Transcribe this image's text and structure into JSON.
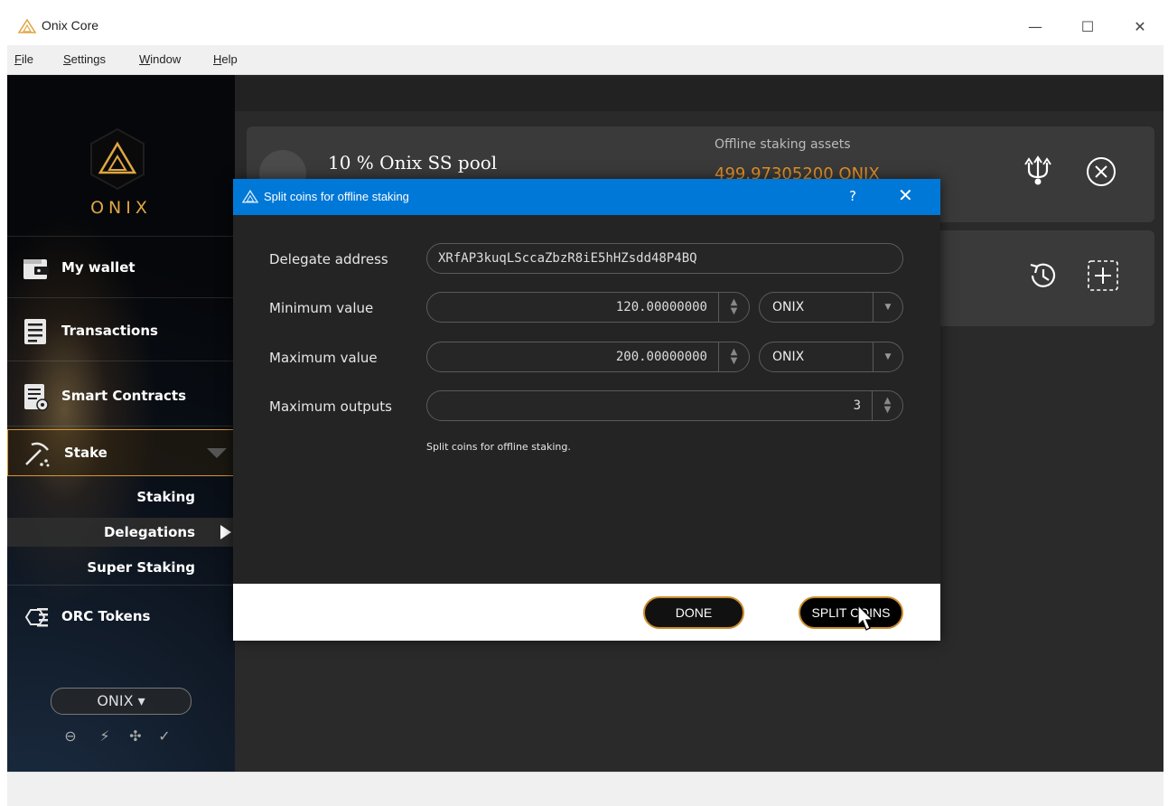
{
  "window": {
    "title": "Onix Core",
    "minimize": "—",
    "maximize": "☐",
    "close": "✕"
  },
  "menu": [
    "File",
    "Settings",
    "Window",
    "Help"
  ],
  "sidebar": {
    "brand": "ONIX",
    "nav": {
      "wallet": "My wallet",
      "transactions": "Transactions",
      "contracts": "Smart Contracts",
      "stake": "Stake",
      "tokens": "ORC Tokens"
    },
    "stake_sub": [
      "Staking",
      "Delegations",
      "Super Staking"
    ],
    "unit_selector": "ONIX ▾"
  },
  "pool_card": {
    "title": "10 % Onix SS pool",
    "assets_label": "Offline staking assets",
    "assets_value": "499.97305200 ONIX"
  },
  "dialog": {
    "title": "Split coins for offline staking",
    "help": "?",
    "close": "✕",
    "fields": {
      "delegate_label": "Delegate address",
      "delegate_value": "XRfAP3kuqLSccaZbzR8iE5hHZsdd48P4BQ",
      "min_label": "Minimum value",
      "min_value": "120.00000000",
      "min_unit": "ONIX",
      "max_label": "Maximum value",
      "max_value": "200.00000000",
      "max_unit": "ONIX",
      "outputs_label": "Maximum outputs",
      "outputs_value": "3"
    },
    "hint": "Split coins for offline staking.",
    "done_button": "DONE",
    "split_button": "SPLIT COINS"
  },
  "colors": {
    "accent": "#e3922a",
    "dialog_header": "#0078d7",
    "background": "#2a2a2a"
  }
}
